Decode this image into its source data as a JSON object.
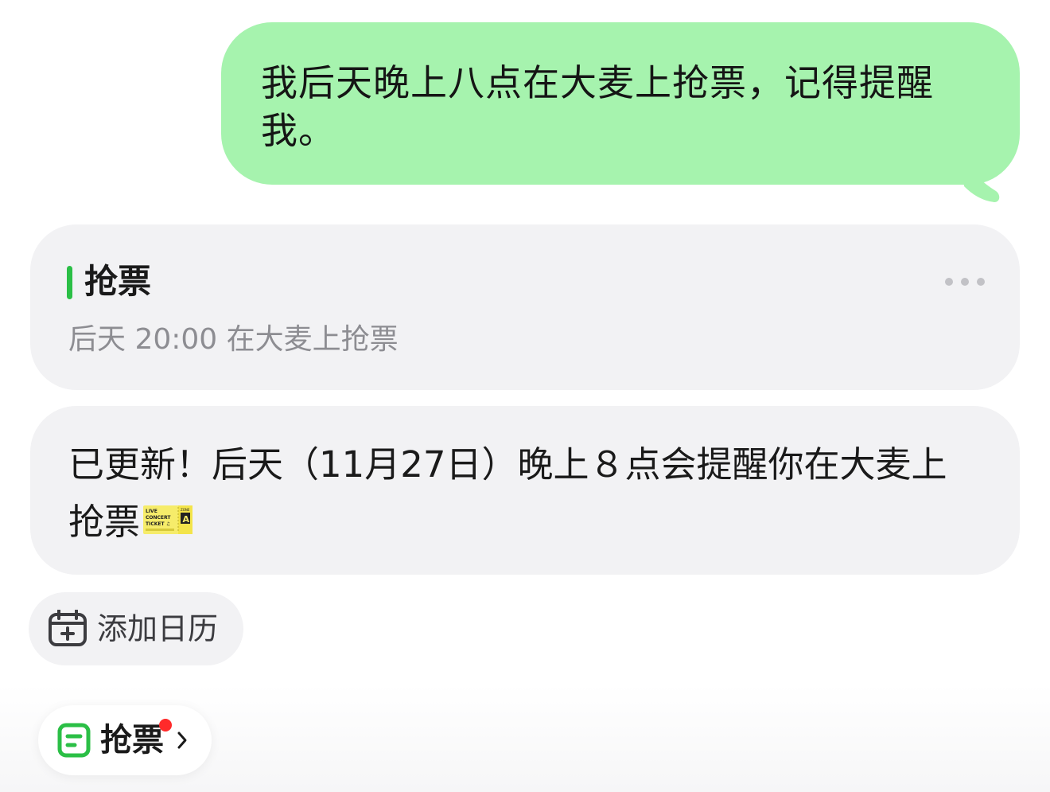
{
  "user_message": {
    "text": "我后天晚上八点在大麦上抢票，记得提醒我。",
    "bubble_color": "#a6f3ae"
  },
  "reminder": {
    "title": "抢票",
    "detail": "后天 20:00 在大麦上抢票",
    "accent_color": "#2bbf46",
    "more_icon": "more-horizontal-icon"
  },
  "reply": {
    "text": "已更新！后天（11月27日）晚上８点会提醒你在大麦上抢票",
    "emoji": "ticket-emoji",
    "emoji_text": {
      "line1": "LIVE",
      "line2": "CONCERT",
      "line3": "TICKET ♫",
      "zone_label": "ZONE",
      "zone": "A"
    }
  },
  "add_calendar": {
    "label": "添加日历",
    "icon": "calendar-add-icon"
  },
  "task_chip": {
    "label": "抢票",
    "icon": "note-icon",
    "badge_color": "#ff2a2a",
    "chevron": "chevron-right-icon"
  }
}
